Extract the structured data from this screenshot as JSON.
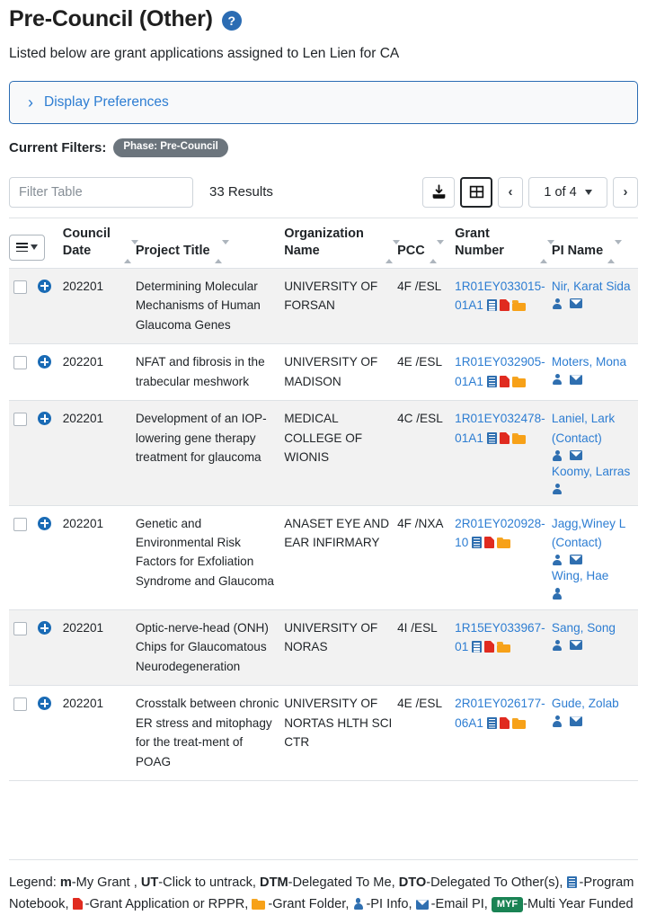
{
  "header": {
    "title": "Pre-Council (Other)",
    "help_icon": "help-circle-icon",
    "subtitle": "Listed below are grant applications assigned to Len Lien for CA"
  },
  "display_preferences": {
    "label": "Display Preferences",
    "chevron": "chevron-right-icon",
    "expanded": false
  },
  "filters": {
    "label": "Current Filters:",
    "chips": [
      {
        "label": "Phase: Pre-Council"
      }
    ]
  },
  "toolbar": {
    "filter_placeholder": "Filter Table",
    "filter_value": "",
    "results": "33 Results",
    "download_icon": "download-icon",
    "grid_icon": "table-view-icon",
    "prev_label": "‹",
    "next_label": "›",
    "page_label": "1 of 4"
  },
  "table": {
    "menu_button": "column-menu-button",
    "columns": [
      {
        "label": "Council Date",
        "sortable": true
      },
      {
        "label": "Project Title",
        "sortable": true
      },
      {
        "label": "Organization Name",
        "sortable": true
      },
      {
        "label": "PCC",
        "sortable": true
      },
      {
        "label": "Grant Number",
        "sortable": true
      },
      {
        "label": "PI Name",
        "sortable": true
      }
    ],
    "rows": [
      {
        "council_date": "202201",
        "project_title": "Determining Molecular Mechanisms of Human Glaucoma Genes",
        "organization": "UNIVERSITY OF FORSAN",
        "pcc": "4F /ESL",
        "grant_number": "1R01EY033015-01A1",
        "grant_icons": [
          "program-notebook-icon",
          "pdf-icon",
          "folder-icon"
        ],
        "pis": [
          {
            "name": "Nir, Karat Sida",
            "contact": false,
            "icons": [
              "pi-info-icon",
              "email-icon"
            ]
          }
        ]
      },
      {
        "council_date": "202201",
        "project_title": "NFAT and fibrosis in the trabecular meshwork",
        "organization": "UNIVERSITY OF MADISON",
        "pcc": "4E /ESL",
        "grant_number": "1R01EY032905-01A1",
        "grant_icons": [
          "program-notebook-icon",
          "pdf-icon",
          "folder-icon"
        ],
        "pis": [
          {
            "name": "Moters, Mona",
            "contact": false,
            "icons": [
              "pi-info-icon",
              "email-icon"
            ]
          }
        ]
      },
      {
        "council_date": "202201",
        "project_title": "Development of an IOP-lowering gene therapy treatment for glaucoma",
        "organization": "MEDICAL COLLEGE OF WIONIS",
        "pcc": "4C /ESL",
        "grant_number": "1R01EY032478-01A1",
        "grant_icons": [
          "program-notebook-icon",
          "pdf-icon",
          "folder-icon"
        ],
        "pis": [
          {
            "name": "Laniel, Lark (Contact)",
            "contact": true,
            "icons": [
              "pi-info-icon",
              "email-icon"
            ]
          },
          {
            "name": "Koomy, Larras",
            "contact": false,
            "icons": [
              "pi-info-icon"
            ]
          }
        ]
      },
      {
        "council_date": "202201",
        "project_title": "Genetic and Environmental Risk Factors for Exfoliation Syndrome and Glaucoma",
        "organization": "ANASET EYE AND EAR INFIRMARY",
        "pcc": "4F /NXA",
        "grant_number": "2R01EY020928-10",
        "grant_icons": [
          "program-notebook-icon",
          "pdf-icon",
          "folder-icon"
        ],
        "pis": [
          {
            "name": "Jagg,Winey L (Contact)",
            "contact": true,
            "icons": [
              "pi-info-icon",
              "email-icon"
            ]
          },
          {
            "name": "Wing, Hae",
            "contact": false,
            "icons": [
              "pi-info-icon"
            ]
          }
        ]
      },
      {
        "council_date": "202201",
        "project_title": "Optic-nerve-head (ONH) Chips for Glaucomatous Neurodegeneration",
        "organization": "UNIVERSITY OF NORAS",
        "pcc": "4I /ESL",
        "grant_number": "1R15EY033967-01",
        "grant_icons": [
          "program-notebook-icon",
          "pdf-icon",
          "folder-icon"
        ],
        "pis": [
          {
            "name": "Sang, Song",
            "contact": false,
            "icons": [
              "pi-info-icon",
              "email-icon"
            ]
          }
        ]
      },
      {
        "council_date": "202201",
        "project_title": "Crosstalk between chronic ER stress and mitophagy for the treat-ment of POAG",
        "organization": "UNIVERSITY OF NORTAS HLTH SCI CTR",
        "pcc": "4E /ESL",
        "grant_number": "2R01EY026177-06A1",
        "grant_icons": [
          "program-notebook-icon",
          "pdf-icon",
          "folder-icon"
        ],
        "pis": [
          {
            "name": "Gude, Zolab",
            "contact": false,
            "icons": [
              "pi-info-icon",
              "email-icon"
            ]
          }
        ]
      }
    ]
  },
  "legend": {
    "prefix": "Legend: ",
    "items": [
      {
        "key": "m",
        "bold": true,
        "text": "-My Grant , "
      },
      {
        "key": "UT",
        "bold": true,
        "text": "-Click to untrack, "
      },
      {
        "key": "DTM",
        "bold": true,
        "text": "-Delegated To Me, "
      },
      {
        "key": "DTO",
        "bold": true,
        "text": "-Delegated To Other(s), "
      }
    ],
    "icon_items": [
      {
        "icon": "program-notebook-icon",
        "text": "-Program Notebook, "
      },
      {
        "icon": "pdf-icon",
        "text": "-Grant Application or RPPR, "
      },
      {
        "icon": "folder-icon",
        "text": "-Grant Folder, "
      },
      {
        "icon": "pi-info-icon",
        "text": "-PI Info, "
      },
      {
        "icon": "email-icon",
        "text": "-Email PI, "
      }
    ],
    "myf_badge": "MYF",
    "myf_text": "-Multi Year Funded"
  },
  "colors": {
    "link": "#2d7dd2",
    "accent": "#2b6cb3",
    "chip": "#6c757d",
    "badge_green": "#1a8354",
    "pdf_red": "#e02b20",
    "folder_orange": "#f7a118"
  }
}
